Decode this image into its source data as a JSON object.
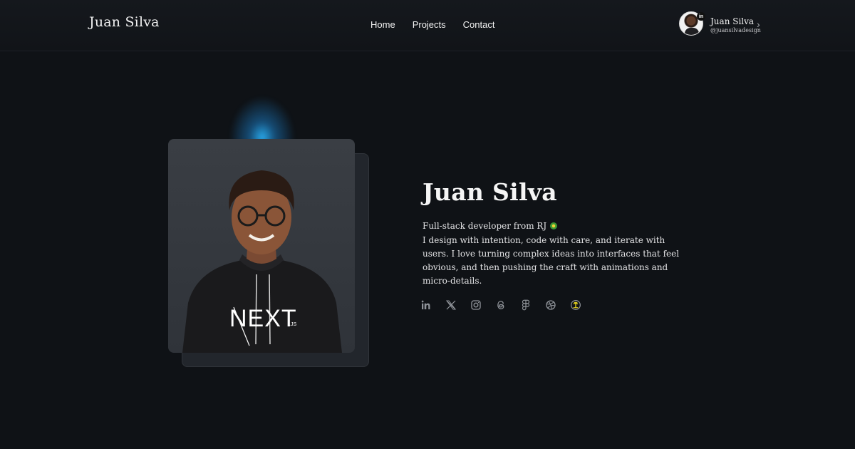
{
  "nav": {
    "brand": "Juan Silva",
    "links": [
      {
        "label": "Home"
      },
      {
        "label": "Projects"
      },
      {
        "label": "Contact"
      }
    ],
    "profile": {
      "name": "Juan Silva",
      "handle": "@juansilvadesign",
      "badge": "in"
    }
  },
  "hero": {
    "name": "Juan Silva",
    "subtitle": "Full-stack developer from RJ",
    "bio": "I design with intention, code with care, and iterate with users. I love turning complex ideas into interfaces that feel obvious, and then pushing the craft with animations and micro-details.",
    "shirt_text": "NEXT",
    "shirt_suffix": ".JS"
  },
  "socials": [
    {
      "icon": "linkedin-icon"
    },
    {
      "icon": "x-icon"
    },
    {
      "icon": "instagram-icon"
    },
    {
      "icon": "threads-icon"
    },
    {
      "icon": "figma-icon"
    },
    {
      "icon": "dribbble-icon"
    },
    {
      "icon": "island-icon"
    }
  ],
  "colors": {
    "background": "#0f1216",
    "accent_glow": "#2ab0f5",
    "text": "#f5f5f5"
  }
}
